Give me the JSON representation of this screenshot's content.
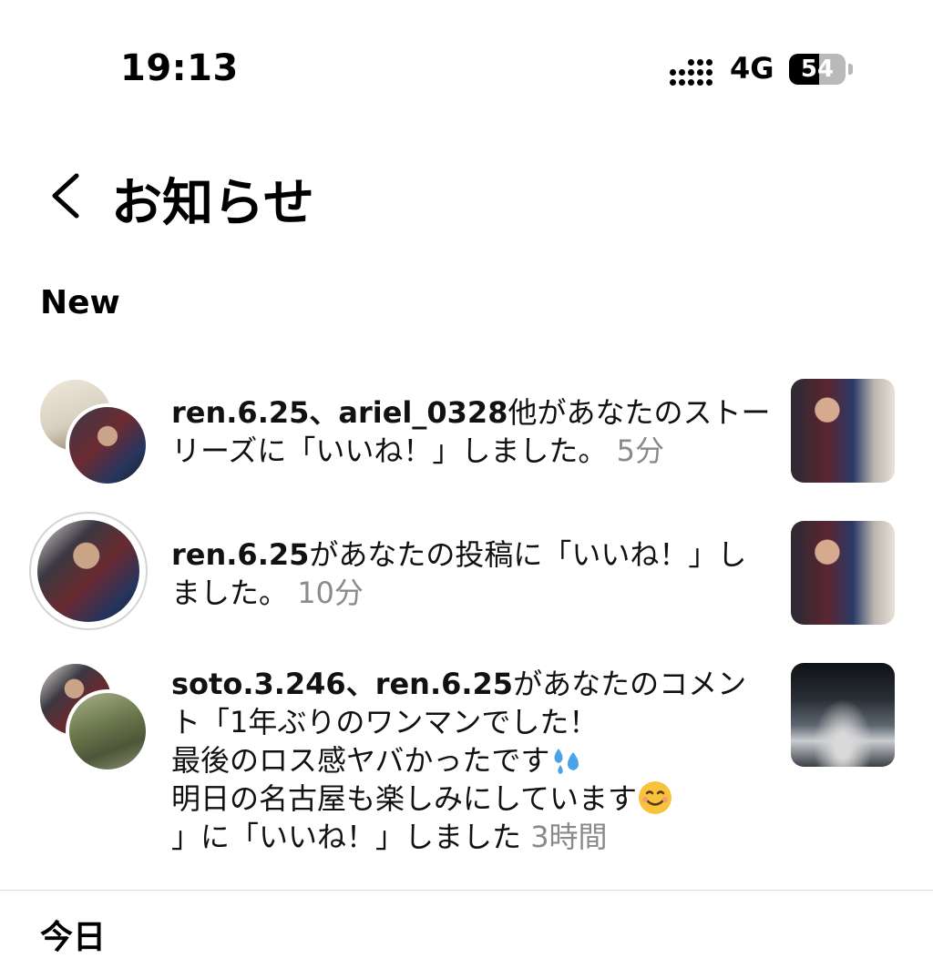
{
  "status_bar": {
    "time": "19:13",
    "network": "4G",
    "battery": "54",
    "battery_level_percent": 54
  },
  "header": {
    "title": "お知らせ"
  },
  "sections": {
    "new": "New",
    "today": "今日"
  },
  "notifications": [
    {
      "users": "ren.6.25、ariel_0328",
      "message": "他があなたのストーリーズに「いいね！」しました。",
      "time": "5分"
    },
    {
      "users": "ren.6.25",
      "message": "があなたの投稿に「いいね！」しました。",
      "time": "10分"
    },
    {
      "users": "soto.3.246、ren.6.25",
      "message_line1": "があなたのコメント「1年ぶりのワンマンでした！",
      "message_line2": "最後のロス感ヤバかったです",
      "message_line3": "明日の名古屋も楽しみにしています",
      "message_line4": "」に「いいね！」しました",
      "time": "3時間",
      "emoji1": "sweat-droplets",
      "emoji2": "smiling-face"
    }
  ]
}
